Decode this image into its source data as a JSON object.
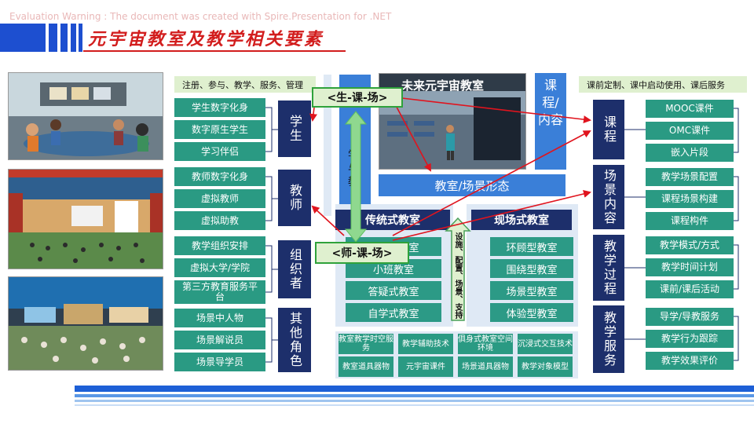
{
  "watermark": "Evaluation Warning : The document was created with  Spire.Presentation for .NET",
  "title": "元宇宙教室及教学相关要素",
  "colors": {
    "title": "#d21d1d",
    "title_bars": "#1d4fd0",
    "teal_box": "#2a9a83",
    "navy_box": "#1d2f6b",
    "arrow_red": "#e0141e",
    "arrow_green": "#8fd88f"
  },
  "left_panel": {
    "top_bar": "注册、参与、教学、服务、管理",
    "groups": [
      {
        "role": "学生",
        "items": [
          "学生数字化身",
          "数字原生学生",
          "学习伴侣"
        ]
      },
      {
        "role": "教师",
        "items": [
          "教师数字化身",
          "虚拟教师",
          "虚拟助教"
        ]
      },
      {
        "role": "组织者",
        "items": [
          "教学组织安排",
          "虚拟大学/学院",
          "第三方教育服务平台"
        ]
      },
      {
        "role": "其他角色",
        "items": [
          "场景中人物",
          "场景解说员",
          "场景导学员"
        ]
      }
    ]
  },
  "center": {
    "screenshot_caption": "未来元宇宙教室",
    "learn_teach": "学与教",
    "course_content": "课程/内容",
    "classroom_form": "教室/场景形态",
    "traditional_header": "传统式教室",
    "traditional_items": [
      "讲授式教室",
      "小班教室",
      "答疑式教室",
      "自学式教室"
    ],
    "onsite_header": "现场式教室",
    "onsite_items": [
      "环顾型教室",
      "围绕型教室",
      "场景型教室",
      "体验型教室"
    ],
    "support_arrow": "设施、配置、场景、支持",
    "support_items": [
      "教室教学时空服务",
      "教学辅助技术",
      "俱身式教室空间环境",
      "沉浸式交互技术",
      "教室道具器物",
      "元宇宙课件",
      "场景道具器物",
      "教学对象模型"
    ]
  },
  "labels": {
    "student_course_scene": "<生-课-场>",
    "teacher_course_scene": "<师-课-场>"
  },
  "right_panel": {
    "top_bar": "课前定制、课中启动使用、课后服务",
    "groups": [
      {
        "role": "课程",
        "items": [
          "MOOC课件",
          "OMC课件",
          "嵌入片段"
        ]
      },
      {
        "role": "场景内容",
        "items": [
          "教学场景配置",
          "课程场景构建",
          "课程构件"
        ]
      },
      {
        "role": "教学过程",
        "items": [
          "教学模式/方式",
          "教学时间计划",
          "课前/课后活动"
        ]
      },
      {
        "role": "教学服务",
        "items": [
          "导学/导教服务",
          "教学行为跟踪",
          "教学效果评价"
        ]
      }
    ]
  }
}
